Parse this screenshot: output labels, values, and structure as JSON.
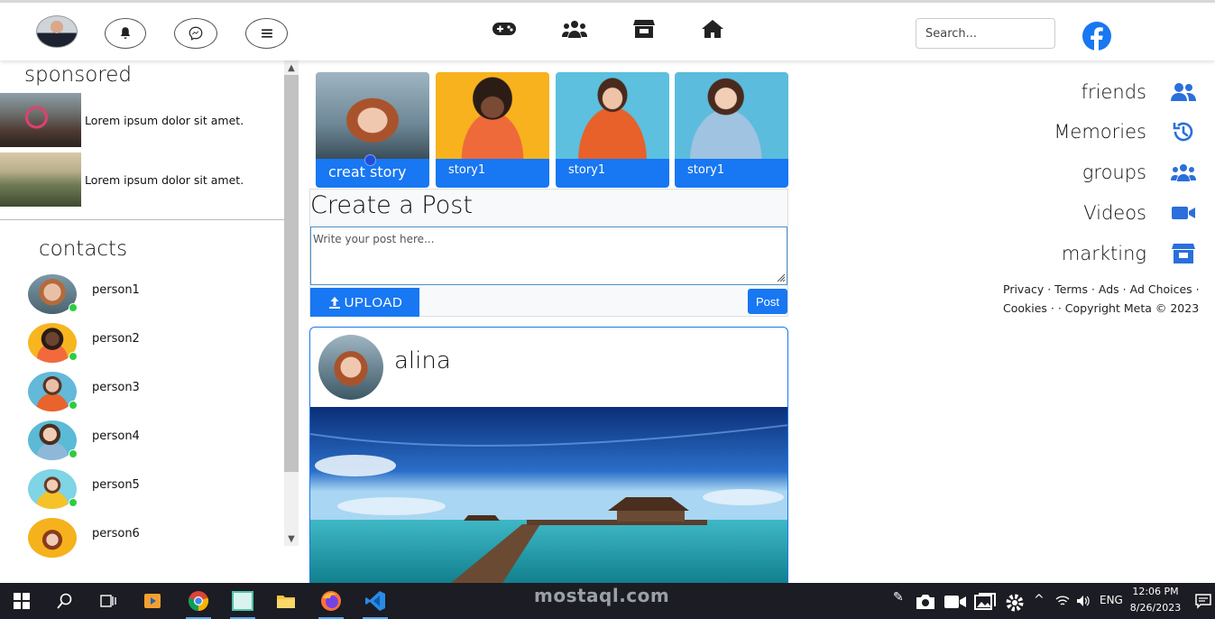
{
  "nav": {
    "search_placeholder": "Search...",
    "top_icons": [
      "user-avatar",
      "bell-icon",
      "messenger-icon",
      "menu-icon"
    ],
    "middle_icons": [
      "gamepad-icon",
      "users-icon",
      "store-icon",
      "home-icon"
    ]
  },
  "sidebar": {
    "sponsored_title": "sponsored",
    "ads": [
      {
        "text": "Lorem ipsum dolor sit amet."
      },
      {
        "text": "Lorem ipsum dolor sit amet."
      }
    ],
    "contacts_title": "contacts",
    "contacts": [
      {
        "name": "person1"
      },
      {
        "name": "person2"
      },
      {
        "name": "person3"
      },
      {
        "name": "person4"
      },
      {
        "name": "person5"
      },
      {
        "name": "person6"
      }
    ]
  },
  "stories": [
    {
      "label": "creat story"
    },
    {
      "label": "story1"
    },
    {
      "label": "story1"
    },
    {
      "label": "story1"
    }
  ],
  "create_post": {
    "title": "Create a Post",
    "placeholder": "Write your post here...",
    "upload_label": "UPLOAD",
    "post_label": "Post"
  },
  "post": {
    "author": "alina"
  },
  "right_menu": [
    {
      "label": "friends",
      "icon": "user-friends-icon"
    },
    {
      "label": "Memories",
      "icon": "history-icon"
    },
    {
      "label": "groups",
      "icon": "users-group-icon"
    },
    {
      "label": "Videos",
      "icon": "video-camera-icon"
    },
    {
      "label": "markting",
      "icon": "store-icon"
    }
  ],
  "footer": {
    "line1": "Privacy · Terms · Ads · Ad Choices ·",
    "line2": "Cookies · · Copyright Meta © 2023"
  },
  "taskbar": {
    "language": "ENG",
    "time": "12:06 PM",
    "date": "8/26/2023",
    "watermark": "mostaql.com"
  },
  "colors": {
    "accent": "#1877f2",
    "taskbar": "#1c1c24",
    "online": "#2ecc40"
  }
}
